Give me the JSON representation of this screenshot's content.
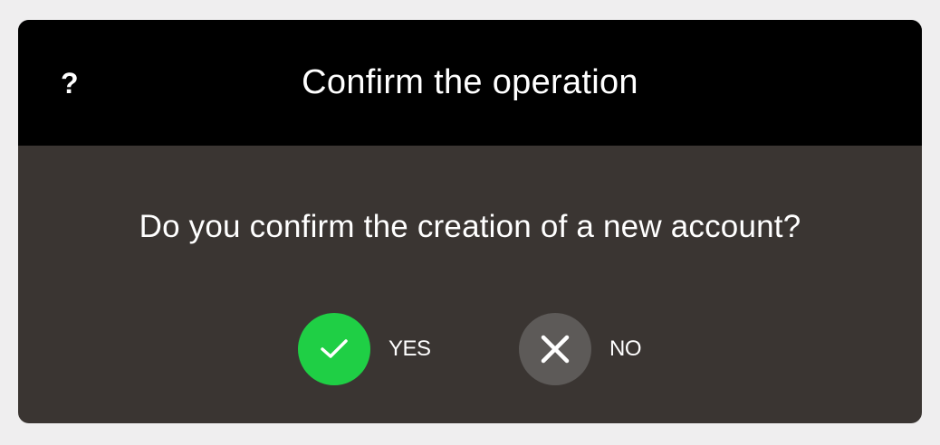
{
  "dialog": {
    "help_icon": "?",
    "title": "Confirm the operation",
    "message": "Do you confirm the creation of a new account?",
    "yes_label": "YES",
    "no_label": "NO",
    "yes_icon": "check-icon",
    "no_icon": "close-icon"
  },
  "colors": {
    "header_bg": "#000000",
    "body_bg": "#3a3532",
    "page_bg": "#efeeef",
    "yes_accent": "#1fcf45",
    "no_accent": "#5d5a58"
  }
}
